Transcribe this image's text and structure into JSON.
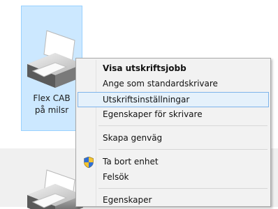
{
  "device": {
    "name_line1": "Flex CAB",
    "name_line2": "på milsr"
  },
  "menu": {
    "items": [
      {
        "label": "Visa utskriftsjobb"
      },
      {
        "label": "Ange som standardskrivare"
      },
      {
        "label": "Utskriftsinställningar"
      },
      {
        "label": "Egenskaper för skrivare"
      },
      {
        "label": "Skapa genväg"
      },
      {
        "label": "Ta bort enhet"
      },
      {
        "label": "Felsök"
      },
      {
        "label": "Egenskaper"
      }
    ]
  },
  "icons": {
    "printer": "printer-icon",
    "shield": "uac-shield-icon"
  },
  "colors": {
    "selection_fill": "#cce8ff",
    "selection_border": "#99d1ff",
    "menu_background": "#f2f2f2",
    "menu_highlight": "#e5f1fb",
    "menu_highlight_border": "#7eb4ea"
  }
}
